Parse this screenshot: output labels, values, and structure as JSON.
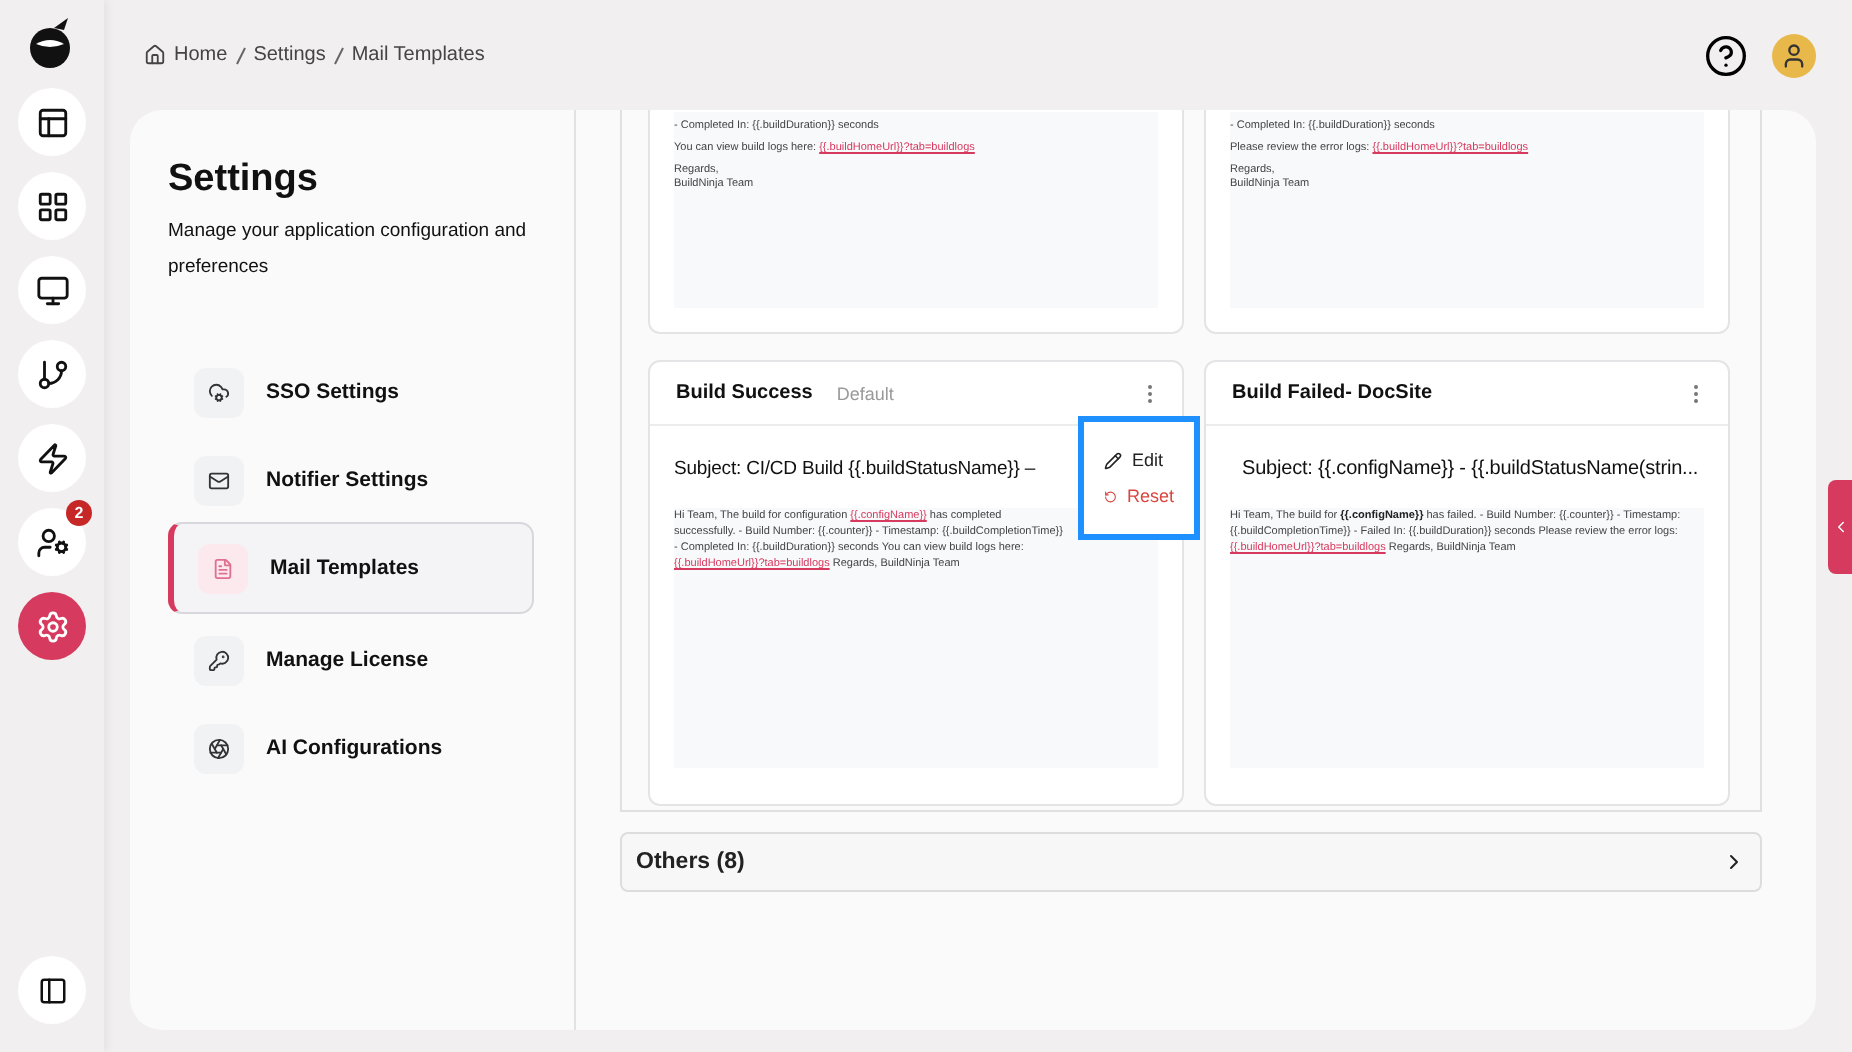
{
  "rail": {
    "items": [
      {
        "selected": false
      },
      {
        "selected": false
      },
      {
        "selected": false
      },
      {
        "selected": false
      },
      {
        "selected": false
      },
      {
        "selected": false,
        "badge": "2"
      },
      {
        "selected": true
      }
    ]
  },
  "breadcrumb": [
    "Home",
    "Settings",
    "Mail Templates"
  ],
  "settings": {
    "title": "Settings",
    "description": "Manage your application configuration and preferences",
    "items": [
      {
        "label": "SSO Settings",
        "selected": false
      },
      {
        "label": "Notifier Settings",
        "selected": false
      },
      {
        "label": "Mail Templates",
        "selected": true
      },
      {
        "label": "Manage License",
        "selected": false
      },
      {
        "label": "AI Configurations",
        "selected": false
      }
    ]
  },
  "top_cards": [
    {
      "lines": [
        [
          {
            "kind": "text",
            "text": "- Completed In: {{.buildDuration}} seconds"
          }
        ],
        [
          {
            "kind": "text",
            "text": "You can view build logs here: "
          },
          {
            "kind": "link",
            "text": "{{.buildHomeUrl}}?tab=buildlogs"
          }
        ],
        [
          {
            "kind": "text",
            "text": "Regards,"
          }
        ],
        [
          {
            "kind": "text",
            "text": "BuildNinja Team"
          }
        ]
      ]
    },
    {
      "lines": [
        [
          {
            "kind": "text",
            "text": "- Completed In: {{.buildDuration}} seconds"
          }
        ],
        [
          {
            "kind": "text",
            "text": "Please review the error logs: "
          },
          {
            "kind": "link",
            "text": "{{.buildHomeUrl}}?tab=buildlogs"
          }
        ],
        [
          {
            "kind": "text",
            "text": "Regards,"
          }
        ],
        [
          {
            "kind": "text",
            "text": "BuildNinja Team"
          }
        ]
      ]
    }
  ],
  "cards": [
    {
      "title": "Build Success",
      "tag": "Default",
      "subject": "Subject: CI/CD Build {{.buildStatusName}} –",
      "body": [
        {
          "kind": "text",
          "text": "Hi Team, The build for configuration "
        },
        {
          "kind": "link",
          "text": "{{.configName}}"
        },
        {
          "kind": "text",
          "text": " has completed successfully. - Build Number: {{.counter}} - Timestamp: {{.buildCompletionTime}} - Completed In: {{.buildDuration}} seconds You can view build logs here: "
        },
        {
          "kind": "link",
          "text": "{{.buildHomeUrl}}?tab=buildlogs"
        },
        {
          "kind": "text",
          "text": " Regards, BuildNinja Team"
        }
      ],
      "menu_open": true
    },
    {
      "title": "Build Failed- DocSite",
      "subject": "Subject: {{.configName}} - {{.buildStatusName(strin...",
      "body": [
        {
          "kind": "text",
          "text": "Hi Team, The build for "
        },
        {
          "kind": "bold",
          "text": "{{.configName}}"
        },
        {
          "kind": "text",
          "text": " has failed. - Build Number: {{.counter}} - Timestamp: {{.buildCompletionTime}} - Failed In: {{.buildDuration}} seconds Please review the error logs: "
        },
        {
          "kind": "link",
          "text": "{{.buildHomeUrl}}?tab=buildlogs"
        },
        {
          "kind": "text",
          "text": " Regards, BuildNinja Team"
        }
      ],
      "menu_open": false
    }
  ],
  "menu": [
    {
      "label": "Edit",
      "kind": "normal"
    },
    {
      "label": "Reset",
      "kind": "danger"
    }
  ],
  "others": {
    "label": "Others (8)",
    "expanded": false
  }
}
